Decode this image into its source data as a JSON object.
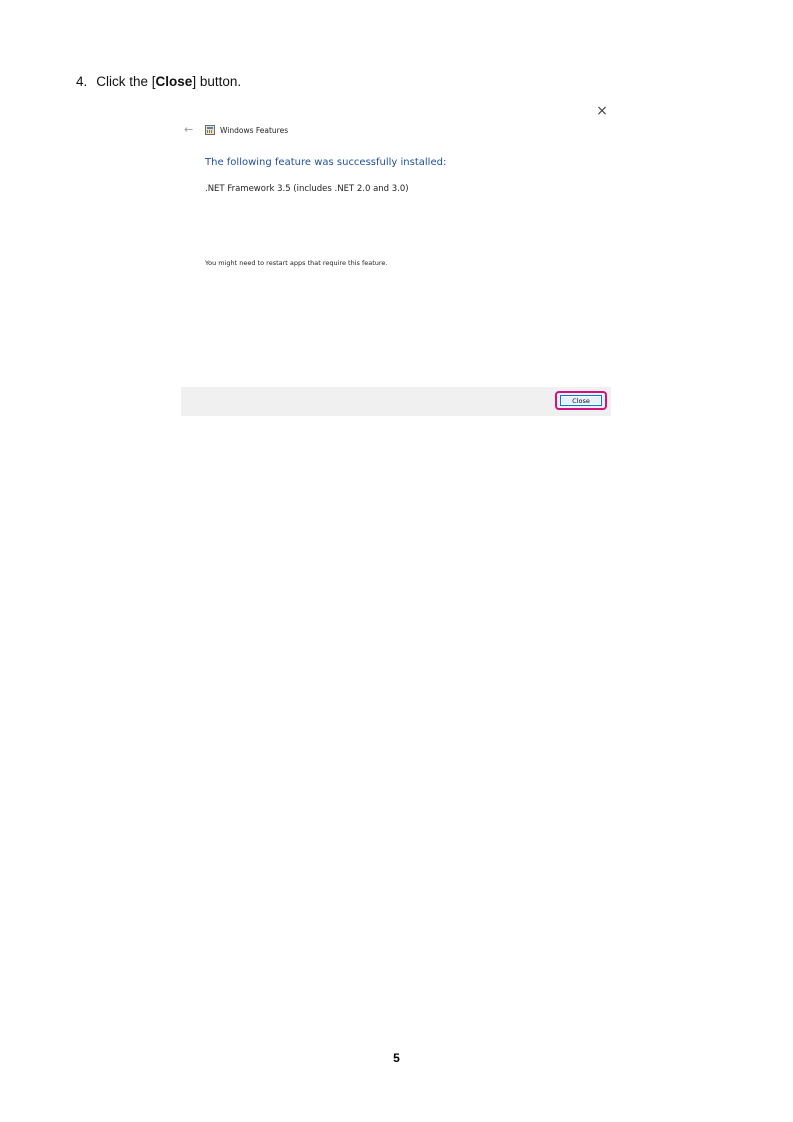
{
  "instruction": {
    "number": "4.",
    "before": "Click the [",
    "emphasis": "Close",
    "after": "] button."
  },
  "dialog": {
    "close_glyph": "×",
    "back_glyph": "←",
    "icon": "windows-features-icon",
    "title": "Windows Features",
    "heading": "The following feature was successfully installed:",
    "feature": ".NET Framework 3.5 (includes .NET 2.0 and 3.0)",
    "note": "You might need to restart apps that require this feature.",
    "close_button_label": "Close",
    "heading_color": "#1f4e9c",
    "highlight_color": "#d4127f",
    "footer_color": "#f0f0f0"
  },
  "page": {
    "number": "5"
  }
}
